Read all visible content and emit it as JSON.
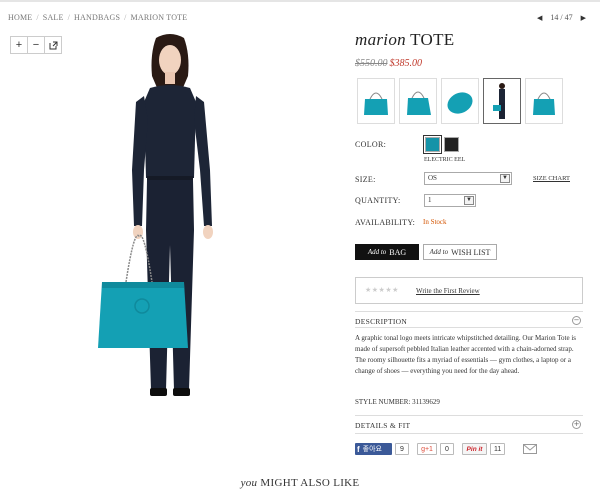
{
  "breadcrumb": [
    "HOME",
    "SALE",
    "HANDBAGS",
    "MARION TOTE"
  ],
  "pager": {
    "position": "14 / 47"
  },
  "zoom": {
    "zoom_in": "+",
    "zoom_out": "−",
    "fullscreen_icon": "expand-icon"
  },
  "product": {
    "title_prefix": "marion",
    "title_main": "TOTE",
    "price_original": "$550.00",
    "price_sale": "$385.00",
    "bag_color": "#14a0b4"
  },
  "thumbnails": [
    "bag-front",
    "bag-angle",
    "bag-folded",
    "model-with-bag",
    "bag-side"
  ],
  "options": {
    "color_label": "COLOR:",
    "colors": [
      {
        "name": "ELECTRIC EEL",
        "hex": "#1593a8"
      },
      {
        "name": "BLACK",
        "hex": "#222222"
      }
    ],
    "selected_color_name": "ELECTRIC EEL",
    "size_label": "SIZE:",
    "size_value": "OS",
    "size_chart": "SIZE CHART",
    "quantity_label": "QUANTITY:",
    "quantity_value": "1",
    "availability_label": "AVAILABILITY:",
    "availability_value": "In Stock"
  },
  "actions": {
    "add_bag_pre": "Add to",
    "add_bag_main": "BAG",
    "wishlist_pre": "Add to",
    "wishlist_main": "WISH LIST"
  },
  "reviews": {
    "stars": "★★★★★",
    "link": "Write the First Review"
  },
  "description": {
    "heading": "DESCRIPTION",
    "toggle": "−",
    "text": "A graphic tonal logo meets intricate whipstitched detailing. Our Marion Tote is made of supersoft pebbled Italian leather accented with a chain-adorned strap. The roomy silhouette fits a myriad of essentials — gym clothes, a laptop or a change of shoes — everything you need for the day ahead.",
    "style_number": "STYLE NUMBER: 31139629"
  },
  "details": {
    "heading": "DETAILS & FIT",
    "toggle": "+"
  },
  "social": {
    "fb_label": "좋아요",
    "fb_count": "9",
    "gplus_label": "g+1",
    "gplus_count": "0",
    "pin_label": "Pin it",
    "pin_count": "11"
  },
  "recommendations": {
    "title_pre": "you",
    "title_main": "MIGHT ALSO LIKE"
  }
}
